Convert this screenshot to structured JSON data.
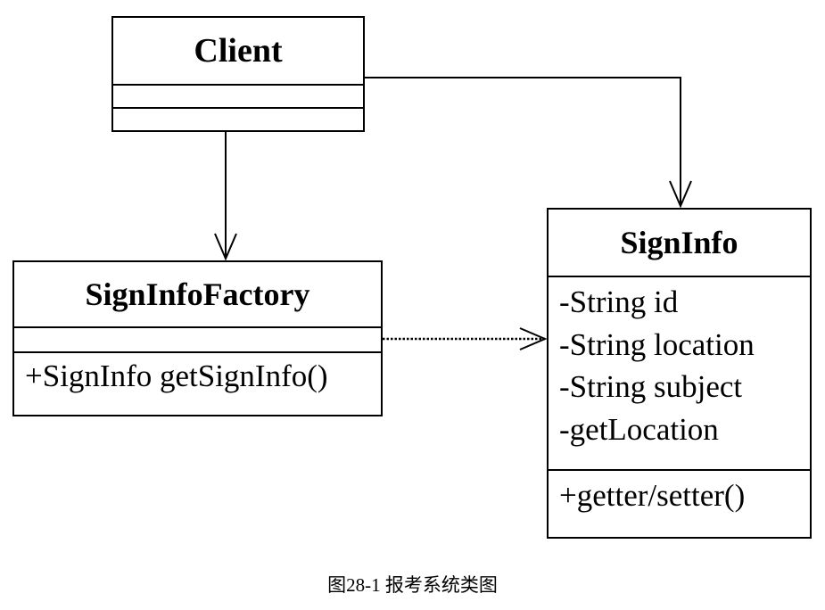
{
  "diagram": {
    "classes": {
      "client": {
        "name": "Client",
        "attributes": [],
        "operations": []
      },
      "factory": {
        "name": "SignInfoFactory",
        "attributes": [],
        "operations": [
          "+SignInfo getSignInfo()"
        ]
      },
      "signinfo": {
        "name": "SignInfo",
        "attributes": [
          "-String id",
          "-String location",
          "-String subject",
          "-getLocation"
        ],
        "operations": [
          "+getter/setter()"
        ]
      }
    },
    "relations": [
      {
        "from": "Client",
        "to": "SignInfoFactory",
        "type": "association"
      },
      {
        "from": "Client",
        "to": "SignInfo",
        "type": "association"
      },
      {
        "from": "SignInfoFactory",
        "to": "SignInfo",
        "type": "dependency"
      }
    ],
    "caption": "图28-1 报考系统类图"
  }
}
